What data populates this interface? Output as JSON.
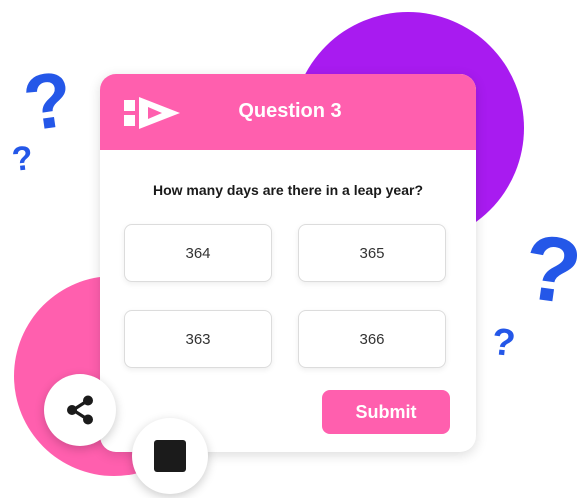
{
  "colors": {
    "header_pink": "#ff5fae",
    "blob_purple": "#a81bf0",
    "blob_pink": "#ff5fae",
    "question_mark_blue": "#2457e8",
    "stop_black": "#1b1b1b"
  },
  "decor": {
    "question_marks": [
      "?",
      "?",
      "?",
      "?"
    ]
  },
  "quiz": {
    "logo_icon": "play-arrow-logo-icon",
    "title": "Question 3",
    "question": "How many days are there in a leap year?",
    "options": [
      "364",
      "365",
      "363",
      "366"
    ],
    "submit_label": "Submit"
  },
  "actions": {
    "share_icon": "share-icon",
    "stop_icon": "stop-icon"
  }
}
